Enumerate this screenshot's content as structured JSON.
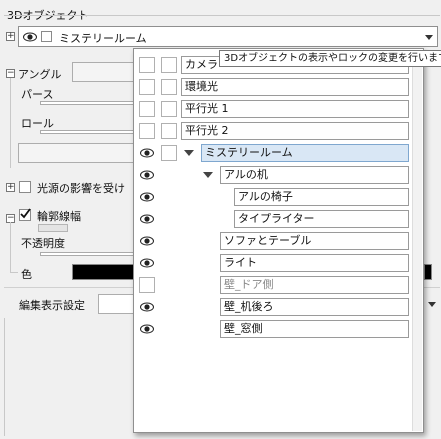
{
  "panel": {
    "title": "3Dオブジェクト",
    "selected_object": "ミステリールーム",
    "angle_label": "アングル",
    "perspective_label": "パース",
    "roll_label": "ロール",
    "light_source_label": "光源の影響を受け",
    "outline_label": "輪郭線幅",
    "opacity_label": "不透明度",
    "color_label": "色",
    "edit_display_label": "編集表示設定"
  },
  "tooltip": "3Dオブジェクトの表示やロックの変更を行います",
  "tree": {
    "rows": [
      {
        "label": "カメラ",
        "eye": false,
        "lock": true,
        "indent": 0
      },
      {
        "label": "環境光",
        "eye": false,
        "lock": true,
        "indent": 0
      },
      {
        "label": "平行光 1",
        "eye": false,
        "lock": true,
        "indent": 0
      },
      {
        "label": "平行光 2",
        "eye": false,
        "lock": true,
        "indent": 0
      },
      {
        "label": "ミステリールーム",
        "eye": true,
        "lock": true,
        "indent": 0,
        "expanded": true,
        "selected": true
      },
      {
        "label": "アルの机",
        "eye": true,
        "lock": false,
        "indent": 1,
        "expanded": true
      },
      {
        "label": "アルの椅子",
        "eye": true,
        "lock": false,
        "indent": 2
      },
      {
        "label": "タイプライター",
        "eye": true,
        "lock": false,
        "indent": 2
      },
      {
        "label": "ソファとテーブル",
        "eye": true,
        "lock": false,
        "indent": 1
      },
      {
        "label": "ライト",
        "eye": true,
        "lock": false,
        "indent": 1
      },
      {
        "label": "壁_ドア側",
        "eye": false,
        "lock": false,
        "indent": 1,
        "hidden": true
      },
      {
        "label": "壁_机後ろ",
        "eye": true,
        "lock": false,
        "indent": 1
      },
      {
        "label": "壁_窓側",
        "eye": true,
        "lock": false,
        "indent": 1
      }
    ]
  }
}
